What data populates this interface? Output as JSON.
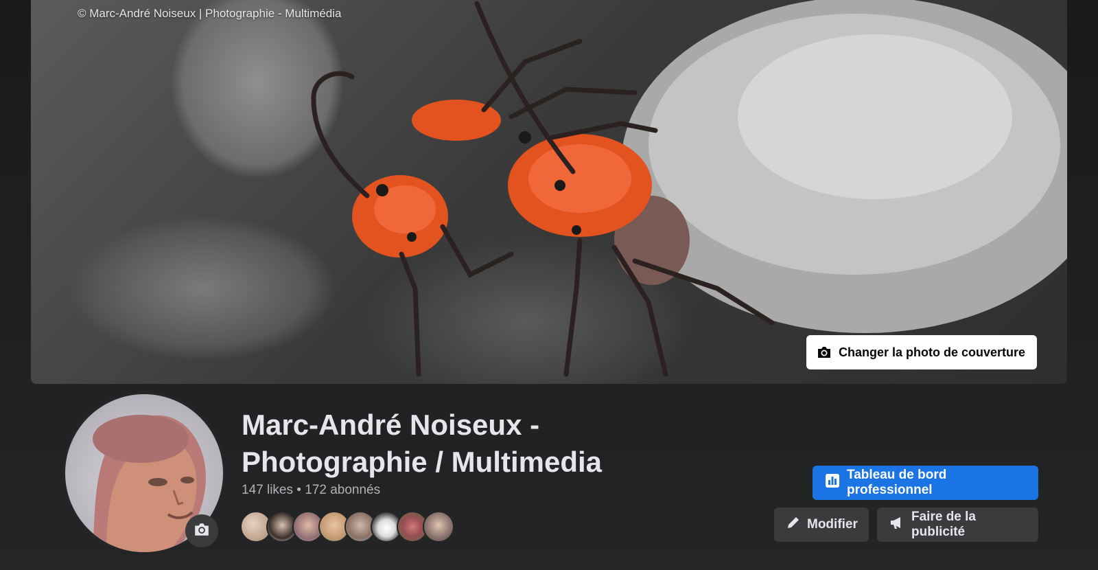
{
  "cover": {
    "watermark": "© Marc-André Noiseux | Photographie - Multimédia",
    "change_cover_label": "Changer la photo de couverture",
    "icon": "camera-icon"
  },
  "profile": {
    "name": "Marc-André Noiseux - Photographie / Multimedia",
    "likes": "147 likes",
    "separator": " • ",
    "followers": "172 abonnés",
    "avatar_icon": "camera-icon"
  },
  "followers_avatars": [
    {
      "color": "#c9a98d"
    },
    {
      "color": "#6b5a4e"
    },
    {
      "color": "#b58f86"
    },
    {
      "color": "#cfae8a"
    },
    {
      "color": "#8d7f74"
    },
    {
      "color": "#d6d6d6"
    },
    {
      "color": "#9b6a6a"
    },
    {
      "color": "#7c6d68"
    }
  ],
  "actions": {
    "dashboard_label": "Tableau de bord professionnel",
    "dashboard_icon": "chart-icon",
    "edit_label": "Modifier",
    "edit_icon": "pencil-icon",
    "promote_label": "Faire de la publicité",
    "promote_icon": "megaphone-icon"
  },
  "colors": {
    "background": "#242526",
    "primary": "#1b74e4",
    "secondary": "#3a3b3c",
    "text": "#e4e6eb",
    "muted": "#b0b3b8"
  }
}
